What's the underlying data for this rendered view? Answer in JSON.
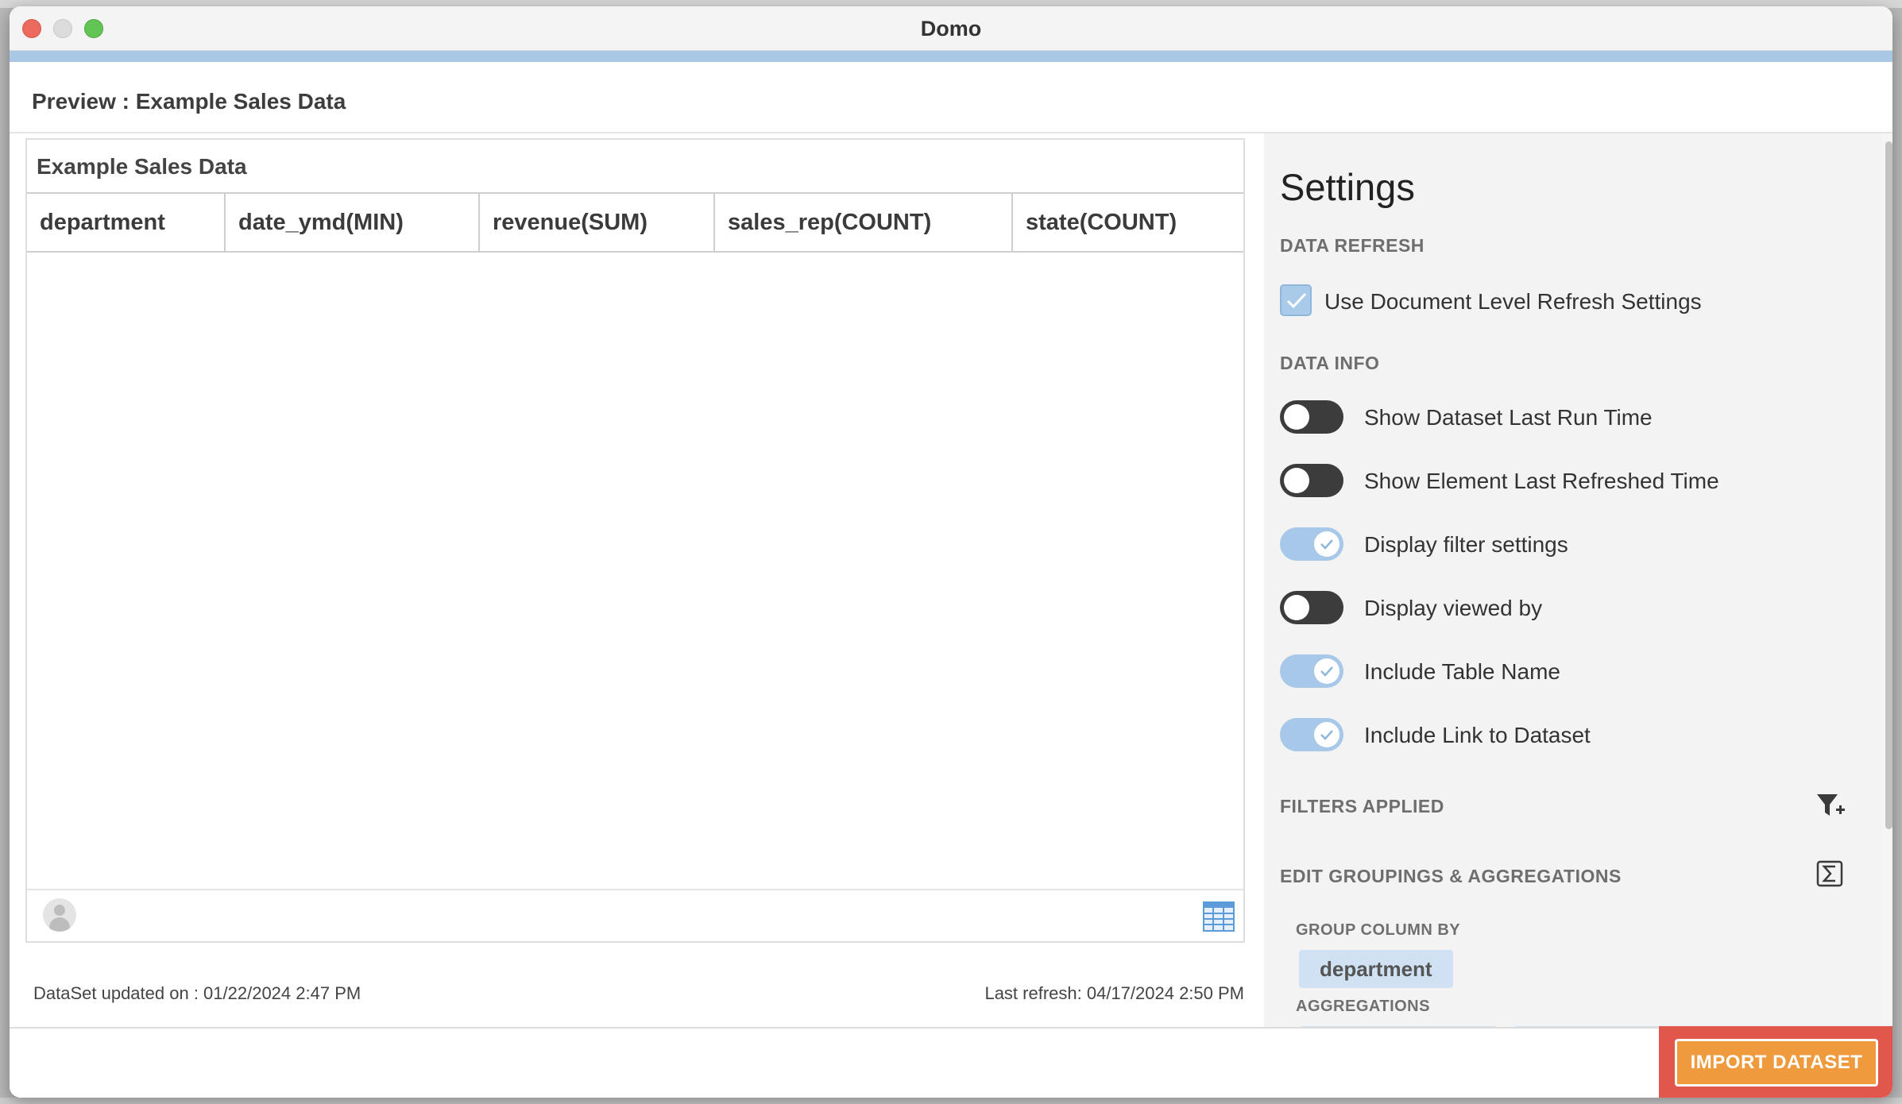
{
  "window": {
    "title": "Domo"
  },
  "dialog": {
    "title": "Preview : Example Sales Data"
  },
  "preview": {
    "table_name": "Example Sales Data",
    "columns": [
      "department",
      "date_ymd(MIN)",
      "revenue(SUM)",
      "sales_rep(COUNT)",
      "state(COUNT)"
    ],
    "dataset_updated": "DataSet updated on : 01/22/2024 2:47 PM",
    "last_refresh": "Last refresh: 04/17/2024 2:50 PM"
  },
  "settings": {
    "title": "Settings",
    "data_refresh": {
      "heading": "DATA REFRESH",
      "use_doc_level": {
        "label": "Use Document Level Refresh Settings",
        "checked": true
      }
    },
    "data_info": {
      "heading": "DATA INFO",
      "toggles": [
        {
          "label": "Show Dataset Last Run Time",
          "on": false
        },
        {
          "label": "Show Element Last Refreshed Time",
          "on": false
        },
        {
          "label": "Display filter settings",
          "on": true
        },
        {
          "label": "Display viewed by",
          "on": false
        },
        {
          "label": "Include Table Name",
          "on": true
        },
        {
          "label": "Include Link to Dataset",
          "on": true
        }
      ]
    },
    "filters_applied": {
      "heading": "FILTERS APPLIED",
      "icon": "filter-add-icon"
    },
    "groupings": {
      "heading": "EDIT GROUPINGS & AGGREGATIONS",
      "icon": "sigma-icon",
      "group_column_by_label": "GROUP COLUMN BY",
      "group_column": "department",
      "aggregations_label": "AGGREGATIONS"
    }
  },
  "footer": {
    "import_button": "IMPORT DATASET"
  },
  "colors": {
    "accent_blue": "#a8c8e6",
    "toggle_on": "#a7c8e8",
    "toggle_off": "#3c3c3c",
    "import_button": "#ef9a3c",
    "highlight": "#e2574b"
  }
}
